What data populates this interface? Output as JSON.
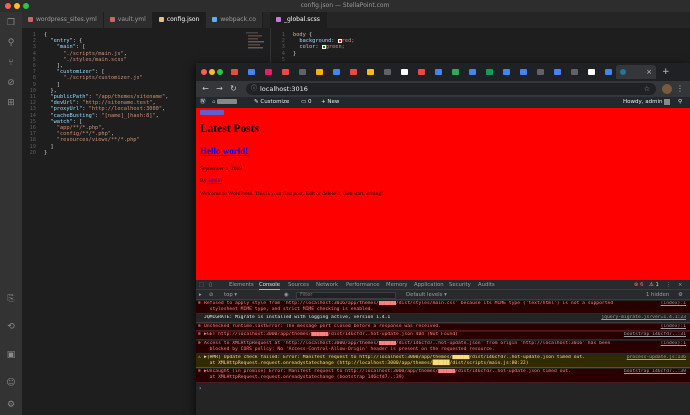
{
  "vscode": {
    "window_title": "config.json — StellaPoint.com",
    "tabs_left": [
      {
        "label": "wordpress_sites.yml",
        "color": "#cc6666"
      },
      {
        "label": "vault.yml",
        "color": "#cc6666"
      },
      {
        "label": "config.json",
        "color": "#e5c07b"
      },
      {
        "label": "webpack.co",
        "color": "#61afef"
      }
    ],
    "tabs_right": [
      {
        "label": "_global.scss",
        "color": "#c678dd"
      }
    ],
    "config_lines": [
      "{",
      "  \"entry\": {",
      "    \"main\": [",
      "      \"./scripts/main.js\",",
      "      \"./styles/main.scss\"",
      "    ],",
      "    \"customizer\": [",
      "      \"./scripts/customizer.js\"",
      "    ]",
      "  },",
      "  \"publicPath\": \"/app/themes/sitename\",",
      "  \"devUrl\": \"http://sitename.test\",",
      "  \"proxyUrl\": \"http://localhost:3000\",",
      "  \"cacheBusting\": \"[name]_[hash:8]\",",
      "  \"watch\": [",
      "    \"app/**/*.php\",",
      "    \"config/**/*.php\",",
      "    \"resources/views/**/*.php\"",
      "  ]",
      "}"
    ],
    "scss_lines": {
      "l1_sel": "body",
      "l1_brace": "{",
      "l2_prop": "background:",
      "l2_val": "red;",
      "l3_prop": "color:",
      "l3_val": "green;",
      "l4": "}"
    }
  },
  "chrome": {
    "url": "localhost:3016",
    "active_tab_close": "×",
    "new_tab": "+"
  },
  "wp_admin_bar": {
    "customize": "Customize",
    "comments_count": "0",
    "new_label": "New",
    "howdy": "Howdy, admin"
  },
  "page": {
    "heading": "Latest Posts",
    "post_title": "Hello world!",
    "post_date": "September 4, 2019",
    "by": "By",
    "author": "admin",
    "body": "Welcome to WordPress. This is your first post. Edit or delete it, then start writing!"
  },
  "devtools": {
    "tabs": [
      "Elements",
      "Console",
      "Sources",
      "Network",
      "Performance",
      "Memory",
      "Application",
      "Security",
      "Audits"
    ],
    "active_tab": "Console",
    "error_count": "6",
    "warn_count": "1",
    "context": "top",
    "filter_placeholder": "Filter",
    "levels": "Default levels ▾",
    "hidden": "1 hidden",
    "messages": [
      {
        "type": "error",
        "text": "Refused to apply style from 'http://localhost:3016/app/themes/██████/dist/styles/main.css' because its MIME type ('text/html') is not a supported\n  stylesheet MIME type, and strict MIME checking is enabled.",
        "src": "(index):1"
      },
      {
        "type": "info",
        "text": "JQMIGRATE: Migrate is installed with logging active, version 1.4.1",
        "src": "jquery-migrate.js?ver=1.4.1:23"
      },
      {
        "type": "error",
        "text": "Unchecked runtime.lastError: The message port closed before a response was received.",
        "src": "(index):1"
      },
      {
        "type": "error",
        "text": "▶GET http://localhost:3000/app/themes/██████/dist/146cfd7..hot-update.json 404 (Not Found)",
        "src": "bootstrap 146cfd7..:31"
      },
      {
        "type": "error",
        "text": "Access to XMLHttpRequest at 'http://localhost:3000/app/themes/██████/dist/146cfd7..hot-update.json' from origin 'http://localhost:3016' has been\n  blocked by CORS policy: No 'Access-Control-Allow-Origin' header is present on the requested resource.",
        "src": "(index):1"
      },
      {
        "type": "warn",
        "text": "▶[HMR] Update check failed: Error: Manifest request to http://localhost:3000/app/themes/██████/dist/146cfd7..hot-update.json timed out.\n  at XMLHttpRequest.request.onreadystatechange (http://localhost:3000/app/themes/██████/dist/scripts/main.js:80:22)",
        "src": "process-update.js:136"
      },
      {
        "type": "error",
        "text": "▶Uncaught (in promise) Error: Manifest request to http://localhost:3000/app/themes/██████/dist/146cfd7..hot-update.json timed out.\n  at XMLHttpRequest.request.onreadystatechange (bootstrap 146cfd7..:39)",
        "src": "bootstrap 146cfd7..:39"
      }
    ]
  },
  "colors": {
    "page_bg": "#ff0000",
    "error_text": "#ff8080",
    "warn_text": "#ffdb80"
  }
}
